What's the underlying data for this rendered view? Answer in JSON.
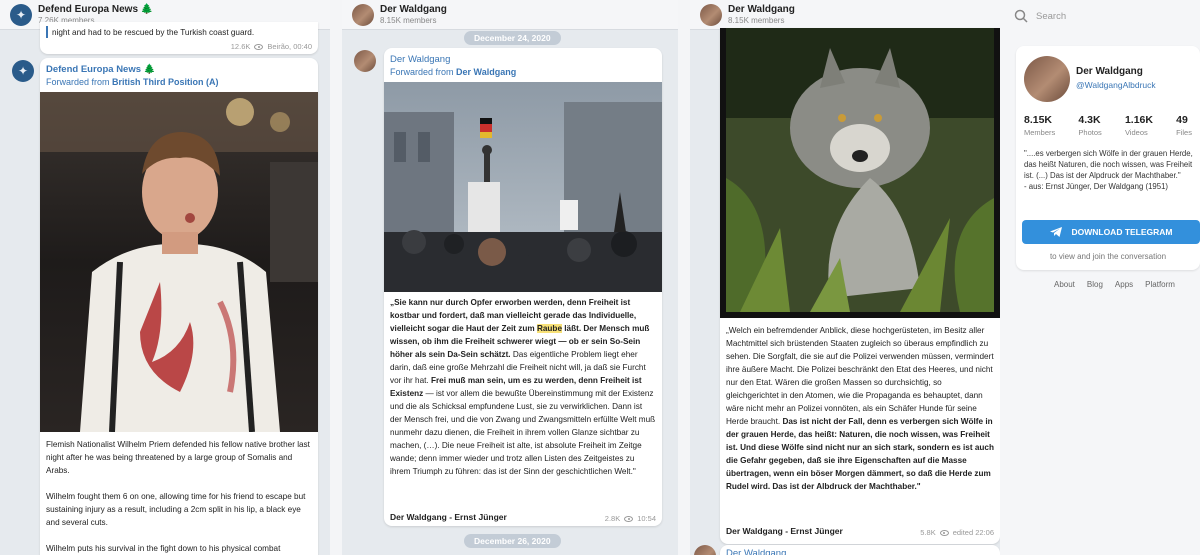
{
  "panel1": {
    "channel_name": "Defend Europa News 🌲",
    "members": "7.26K members",
    "top_snippet": "night and had to be rescued by the Turkish coast guard.",
    "top_views": "12.6K",
    "top_meta": "Beirão, 00:40",
    "post": {
      "name": "Defend Europa News 🌲",
      "forwarded_prefix": "Forwarded from ",
      "forwarded_from": "British Third Position (A)",
      "p1": "Flemish Nationalist Wilhelm Priem defended his fellow native brother last night after he was being threatened by a large group of Somalis and Arabs.",
      "p2": "Wilhelm fought them 6 on one, allowing time for his friend to escape but sustaining injury as a result, including a 2cm split in his lip, a black eye and several cuts.",
      "p3": "Wilhelm puts his survival in the fight down to his physical combat"
    }
  },
  "panel2": {
    "channel_name": "Der Waldgang",
    "members": "8.15K members",
    "date1": "December 24, 2020",
    "date2": "December 26, 2020",
    "post": {
      "name": "Der Waldgang",
      "forwarded_prefix": "Forwarded from ",
      "forwarded_from": "Der Waldgang",
      "t1": "„Sie kann nur durch Opfer erworben werden, denn Freiheit ist kostbar und fordert, daß man vielleicht gerade das Individuelle, vielleicht sogar die Haut der Zeit zum ",
      "t_hl": "Raube",
      "t2": " läßt. Der Mensch muß wissen, ob ihm die Freiheit schwerer wiegt — ob er sein So-Sein höher als sein Da-Sein schätzt.",
      "t3": " Das eigentliche Problem liegt eher darin, daß eine große Mehrzahl die Freiheit nicht will, ja daß sie Furcht vor ihr hat. ",
      "t4": "Frei muß man sein, um es zu werden, denn Freiheit ist Existenz",
      "t5": " — ist vor allem die bewußte Übereinstimmung mit der Existenz und die als Schicksal empfundene Lust, sie zu verwirklichen. Dann ist der Mensch frei, und die von Zwang und Zwangsmitteln erfüllte Welt muß nunmehr dazu dienen, die Freiheit in ihrem vollen Glanze sichtbar zu machen, (…). Die neue Freiheit ist alte, ist absolute Freiheit im Zeitge wande; denn immer wieder und trotz allen Listen des Zeitgeistes zu ihrem Triumph zu führen: das ist der Sinn der geschichtlichen Welt.\"",
      "signature": "Der Waldgang - Ernst Jünger",
      "views": "2.8K",
      "time": "10:54"
    },
    "next_name": "Der Waldgang"
  },
  "panel3": {
    "channel_name": "Der Waldgang",
    "members": "8.15K members",
    "post": {
      "t1": "„Welch ein befremdender Anblick, diese hochgerüsteten, im Besitz aller Machtmittel sich brüstenden Staaten zugleich so überaus empfindlich zu sehen. Die Sorgfalt, die sie auf die Polizei verwenden müssen, vermindert ihre äußere Macht. Die Polizei beschränkt den Etat des Heeres, und nicht nur den Etat. Wären die großen Massen so durchsichtig, so gleichgerichtet in den Atomen, wie die Propaganda es behauptet, dann wäre nicht mehr an Polizei vonnöten, als ein Schäfer Hunde für seine Herde braucht. ",
      "t2": "Das ist nicht der Fall, denn es verbergen sich Wölfe in der grauen Herde, das heißt: Naturen, die noch wissen, was Freiheit ist. Und diese Wölfe sind nicht nur an sich stark, sondern es ist auch die Gefahr gegeben, daß sie ihre Eigenschaften auf die Masse übertragen, wenn ein böser Morgen dämmert, so daß die Herde zum Rudel wird. Das ist der Albdruck der Machthaber.\"",
      "signature": "Der Waldgang - Ernst Jünger",
      "views": "5.8K",
      "time": "edited  22:06"
    },
    "next_name": "Der Waldgang"
  },
  "sidebar": {
    "search_placeholder": "Search",
    "channel_name": "Der Waldgang",
    "handle": "@WaldgangAlbdruck",
    "stats": [
      {
        "value": "8.15K",
        "label": "Members"
      },
      {
        "value": "4.3K",
        "label": "Photos"
      },
      {
        "value": "1.16K",
        "label": "Videos"
      },
      {
        "value": "49",
        "label": "Files"
      }
    ],
    "description": "\"....es verbergen sich Wölfe in der grauen Herde, das heißt Naturen, die noch wissen, was Freiheit ist. (...) Das ist der Alpdruck der Machthaber.\"",
    "description_source": "- aus: Ernst Jünger, Der Waldgang (1951)",
    "download_label": "DOWNLOAD TELEGRAM",
    "view_join": "to view and join the conversation",
    "footer": [
      "About",
      "Blog",
      "Apps",
      "Platform"
    ]
  }
}
